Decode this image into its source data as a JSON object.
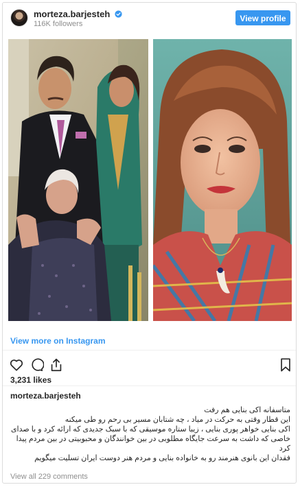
{
  "header": {
    "username": "morteza.barjesteh",
    "followers": "116K followers",
    "view_profile_label": "View profile"
  },
  "links": {
    "view_more": "View more on Instagram",
    "view_comments": "View all 229 comments"
  },
  "post": {
    "likes": "3,231 likes",
    "owner": "morteza.barjesteh",
    "caption_lines": [
      "متاسفانه اکی بنایی هم رفت",
      "این قطار وقتی به حرکت در میاد ، چه شتابان مسیر بی رحم رو طی میکنه",
      "اکی بنایی خواهر پوری بنایی ، زیبا ستاره موسیقی که با سبک جدیدی که ارائه کرد و با صدای خاصی که داشت به سرعت جایگاه مطلوبی در بین خوانندگان و محبوبیتی در بین مردم پیدا کرد",
      "فقدان این بانوی هنرمند رو به خانواده بنایی و مردم هنر دوست ایران تسلیت میگویم"
    ]
  },
  "icons": {
    "verified": "verified-badge-icon",
    "like": "heart-icon",
    "comment": "comment-bubble-icon",
    "share": "share-icon",
    "save": "bookmark-icon"
  },
  "colors": {
    "accent": "#3897f0",
    "text": "#262626",
    "muted": "#8e8e8e",
    "border": "#dbdbdb"
  }
}
